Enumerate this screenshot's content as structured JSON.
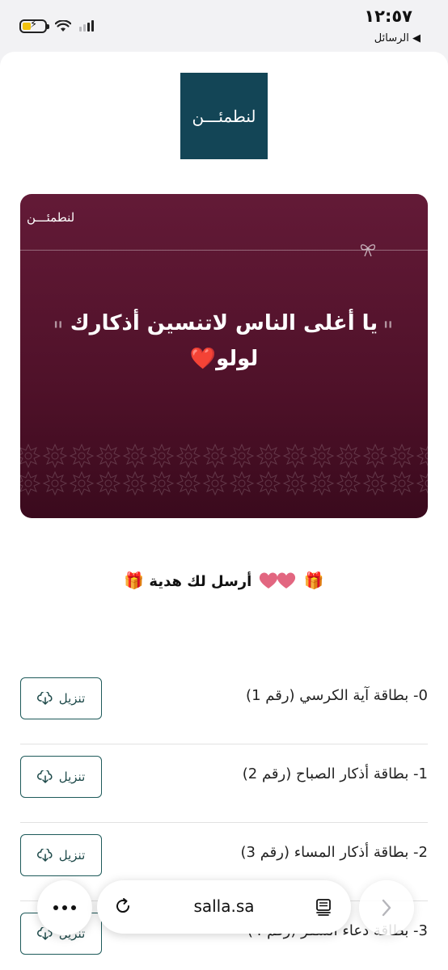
{
  "status_bar": {
    "time": "١٢:٥٧",
    "back_label": "◀ الرسائل"
  },
  "brand": {
    "logo_text": "لنطمئـــن",
    "card_brand_text": "لنطمئـــن"
  },
  "card": {
    "message": "يا أغلى الناس لاتنسين أذكارك لولو❤️",
    "open_quote": "\"",
    "close_quote": "\"",
    "background_color": "#5a1530"
  },
  "sender": {
    "text": "أرسل لك هدية",
    "gift_emoji": "🎁"
  },
  "downloads": [
    {
      "title": "0- بطاقة آية الكرسي (رقم 1)",
      "button_label": "تنزيل"
    },
    {
      "title": "1- بطاقة أذكار الصباح (رقم 2)",
      "button_label": "تنزيل"
    },
    {
      "title": "2- بطاقة أذكار المساء (رقم 3)",
      "button_label": "تنزيل"
    },
    {
      "title": "3- بطاقة دعاء السفر (رقم 4)",
      "button_label": "تنزيل"
    }
  ],
  "browser": {
    "url": "salla.sa",
    "icons": [
      "more-icon",
      "reload-icon",
      "reader-icon",
      "forward-icon"
    ]
  },
  "colors": {
    "logo_bg": "#134556",
    "button_border": "#1e5a5a"
  }
}
